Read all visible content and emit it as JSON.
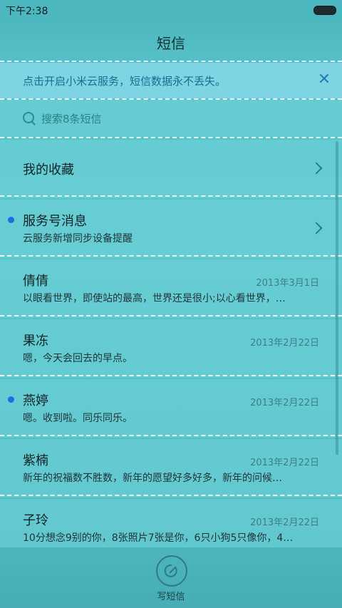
{
  "status_bar": {
    "time": "下午2:38"
  },
  "header": {
    "title": "短信"
  },
  "banner": {
    "text": "点击开启小米云服务，短信数据永不丢失。"
  },
  "search": {
    "placeholder": "搜索8条短信"
  },
  "favorites": {
    "label": "我的收藏"
  },
  "conversations": [
    {
      "name": "服务号消息",
      "preview": "云服务新增同步设备提醒",
      "date": "",
      "unread": true,
      "chevron": true
    },
    {
      "name": "倩倩",
      "preview": "以眼看世界，即使站的最高，世界还是很小;以心看世界，…",
      "date": "2013年3月1日",
      "unread": false,
      "chevron": false
    },
    {
      "name": "果冻",
      "preview": "嗯，今天会回去的早点。",
      "date": "2013年2月22日",
      "unread": false,
      "chevron": false
    },
    {
      "name": "燕婷",
      "preview": "嗯。收到啦。同乐同乐。",
      "date": "2013年2月22日",
      "unread": true,
      "chevron": false
    },
    {
      "name": "紫楠",
      "preview": "新年的祝福数不胜数，新年的愿望好多好多，新年的问候…",
      "date": "2013年2月22日",
      "unread": false,
      "chevron": false
    },
    {
      "name": "子玲",
      "preview": "10分想念9别的你，8张照片7张是你，6只小狗5只像你，4…",
      "date": "2013年2月22日",
      "unread": false,
      "chevron": false
    }
  ],
  "bottom_bar": {
    "compose_label": "写短信"
  },
  "colors": {
    "unread_dot": "#1a6fe8",
    "banner_text": "#1b6c8d",
    "background": "#59c6cd"
  }
}
